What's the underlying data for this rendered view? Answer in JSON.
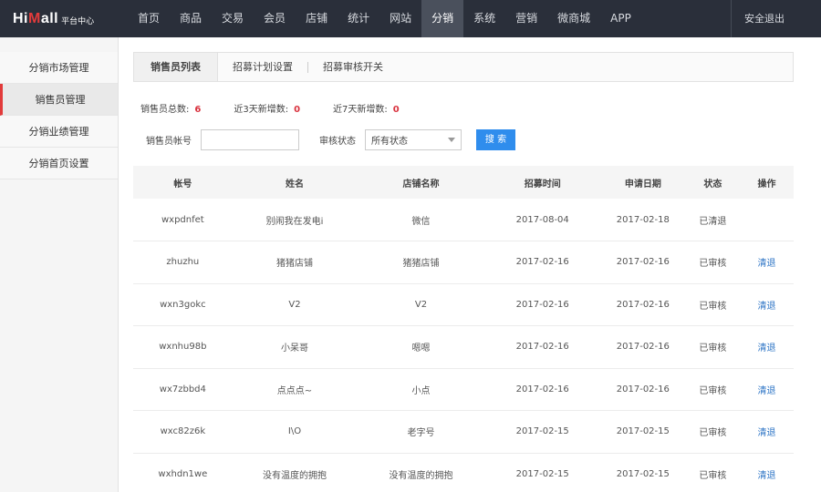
{
  "brand": {
    "name_a": "Hi",
    "name_b": "M",
    "name_c": "all",
    "subtitle": "平台中心"
  },
  "nav": [
    "首页",
    "商品",
    "交易",
    "会员",
    "店铺",
    "统计",
    "网站",
    "分销",
    "系统",
    "营销",
    "微商城",
    "APP"
  ],
  "nav_active_index": 7,
  "logout_label": "安全退出",
  "sidebar": [
    "分销市场管理",
    "销售员管理",
    "分销业绩管理",
    "分销首页设置"
  ],
  "sidebar_active_index": 1,
  "tabs": [
    "销售员列表",
    "招募计划设置",
    "招募审核开关"
  ],
  "stats": [
    {
      "label": "销售员总数:",
      "value": "6"
    },
    {
      "label": "近3天新增数:",
      "value": "0"
    },
    {
      "label": "近7天新增数:",
      "value": "0"
    }
  ],
  "filter": {
    "account_label": "销售员帐号",
    "account_value": "",
    "status_label": "审核状态",
    "status_selected": "所有状态",
    "search_label": "搜 索"
  },
  "table": {
    "headers": [
      "帐号",
      "姓名",
      "店铺名称",
      "招募时间",
      "申请日期",
      "状态",
      "操作"
    ],
    "rows": [
      [
        "wxpdnfet",
        "别闹我在发电i",
        "微信",
        "2017-08-04",
        "2017-02-18",
        "已清退",
        ""
      ],
      [
        "zhuzhu",
        "猪猪店铺",
        "猪猪店铺",
        "2017-02-16",
        "2017-02-16",
        "已审核",
        "清退"
      ],
      [
        "wxn3gokc",
        "V2",
        "V2",
        "2017-02-16",
        "2017-02-16",
        "已审核",
        "清退"
      ],
      [
        "wxnhu98b",
        "小呆哥",
        "嗯嗯",
        "2017-02-16",
        "2017-02-16",
        "已审核",
        "清退"
      ],
      [
        "wx7zbbd4",
        "点点点~",
        "小点",
        "2017-02-16",
        "2017-02-16",
        "已审核",
        "清退"
      ],
      [
        "wxc82z6k",
        "I\\O",
        "老字号",
        "2017-02-15",
        "2017-02-15",
        "已审核",
        "清退"
      ],
      [
        "wxhdn1we",
        "没有温度的拥抱",
        "没有温度的拥抱",
        "2017-02-15",
        "2017-02-15",
        "已审核",
        "清退"
      ]
    ]
  },
  "colors": {
    "topbar": "#2a2f3a",
    "accent_red": "#e23b3b",
    "link_blue": "#2f76c6",
    "button_blue": "#2f8ded"
  }
}
